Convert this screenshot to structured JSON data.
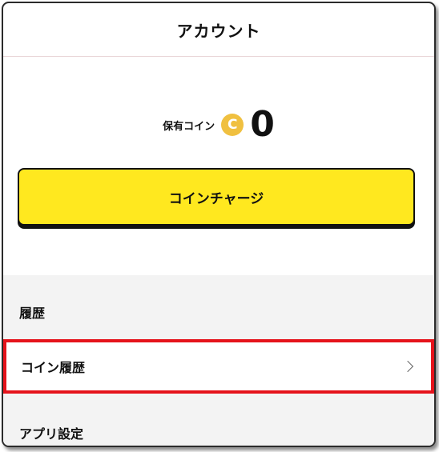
{
  "header": {
    "title": "アカウント"
  },
  "balance": {
    "label": "保有コイン",
    "coin_symbol": "C",
    "value": "0"
  },
  "charge_button": {
    "label": "コインチャージ"
  },
  "sections": {
    "history": {
      "title": "履歴"
    },
    "app_settings": {
      "title": "アプリ設定"
    }
  },
  "history_items": [
    {
      "label": "コイン履歴"
    }
  ],
  "colors": {
    "accent": "#ffe81f",
    "coin": "#f0c040",
    "highlight": "#e5131b"
  }
}
